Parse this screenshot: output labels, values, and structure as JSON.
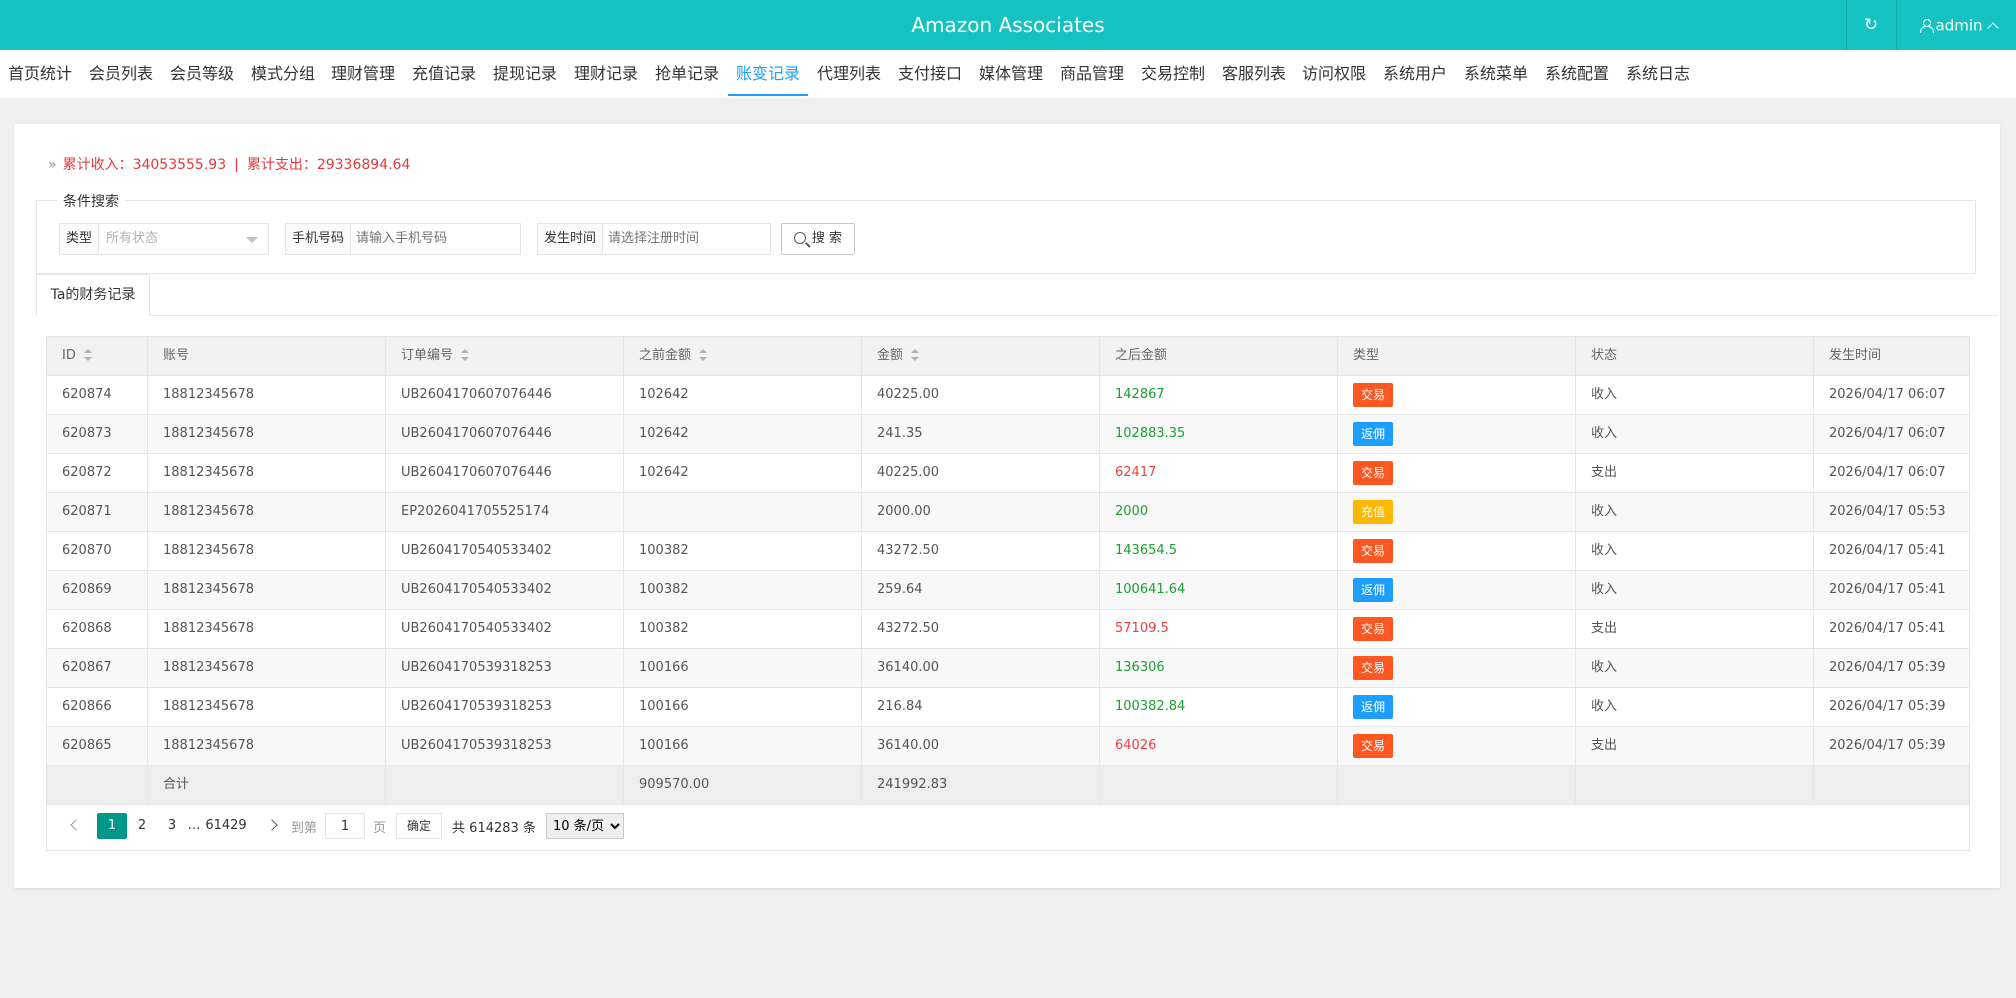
{
  "app": {
    "title": "Amazon Associates",
    "user": "admin",
    "refresh_icon": "refresh-icon",
    "brand_color": "#14c2c2"
  },
  "nav": {
    "active": 9,
    "items": [
      "首页统计",
      "会员列表",
      "会员等级",
      "模式分组",
      "理财管理",
      "充值记录",
      "提现记录",
      "理财记录",
      "抢单记录",
      "账变记录",
      "代理列表",
      "支付接口",
      "媒体管理",
      "商品管理",
      "交易控制",
      "客服列表",
      "访问权限",
      "系统用户",
      "系统菜单",
      "系统配置",
      "系统日志"
    ]
  },
  "summary": {
    "income_label": "累计收入：",
    "income_value": "34053555.93",
    "separator": "|",
    "expense_label": "累计支出：",
    "expense_value": "29336894.64"
  },
  "search": {
    "legend": "条件搜索",
    "type_label": "类型",
    "type_value": "所有状态",
    "phone_label": "手机号码",
    "phone_placeholder": "请输入手机号码",
    "time_label": "发生时间",
    "time_placeholder": "请选择注册时间",
    "button": "搜 索"
  },
  "tab": {
    "label": "Ta的财务记录"
  },
  "table": {
    "columns": [
      "ID",
      "账号",
      "订单编号",
      "之前金额",
      "金额",
      "之后金额",
      "类型",
      "状态",
      "发生时间"
    ],
    "rows": [
      {
        "id": "620874",
        "account": "18812345678",
        "order": "UB2604170607076446",
        "before": "102642",
        "amount": "40225.00",
        "after": "142867",
        "after_color": "green",
        "type": "交易",
        "type_color": "#ff5722",
        "status": "收入",
        "time": "2026/04/17 06:07"
      },
      {
        "id": "620873",
        "account": "18812345678",
        "order": "UB2604170607076446",
        "before": "102642",
        "amount": "241.35",
        "after": "102883.35",
        "after_color": "green",
        "type": "返佣",
        "type_color": "#1e9fff",
        "status": "收入",
        "time": "2026/04/17 06:07"
      },
      {
        "id": "620872",
        "account": "18812345678",
        "order": "UB2604170607076446",
        "before": "102642",
        "amount": "40225.00",
        "after": "62417",
        "after_color": "red",
        "type": "交易",
        "type_color": "#ff5722",
        "status": "支出",
        "time": "2026/04/17 06:07"
      },
      {
        "id": "620871",
        "account": "18812345678",
        "order": "EP2026041705525174",
        "before": "",
        "amount": "2000.00",
        "after": "2000",
        "after_color": "green",
        "type": "充值",
        "type_color": "#ffb800",
        "status": "收入",
        "time": "2026/04/17 05:53"
      },
      {
        "id": "620870",
        "account": "18812345678",
        "order": "UB2604170540533402",
        "before": "100382",
        "amount": "43272.50",
        "after": "143654.5",
        "after_color": "green",
        "type": "交易",
        "type_color": "#ff5722",
        "status": "收入",
        "time": "2026/04/17 05:41"
      },
      {
        "id": "620869",
        "account": "18812345678",
        "order": "UB2604170540533402",
        "before": "100382",
        "amount": "259.64",
        "after": "100641.64",
        "after_color": "green",
        "type": "返佣",
        "type_color": "#1e9fff",
        "status": "收入",
        "time": "2026/04/17 05:41"
      },
      {
        "id": "620868",
        "account": "18812345678",
        "order": "UB2604170540533402",
        "before": "100382",
        "amount": "43272.50",
        "after": "57109.5",
        "after_color": "red",
        "type": "交易",
        "type_color": "#ff5722",
        "status": "支出",
        "time": "2026/04/17 05:41"
      },
      {
        "id": "620867",
        "account": "18812345678",
        "order": "UB2604170539318253",
        "before": "100166",
        "amount": "36140.00",
        "after": "136306",
        "after_color": "green",
        "type": "交易",
        "type_color": "#ff5722",
        "status": "收入",
        "time": "2026/04/17 05:39"
      },
      {
        "id": "620866",
        "account": "18812345678",
        "order": "UB2604170539318253",
        "before": "100166",
        "amount": "216.84",
        "after": "100382.84",
        "after_color": "green",
        "type": "返佣",
        "type_color": "#1e9fff",
        "status": "收入",
        "time": "2026/04/17 05:39"
      },
      {
        "id": "620865",
        "account": "18812345678",
        "order": "UB2604170539318253",
        "before": "100166",
        "amount": "36140.00",
        "after": "64026",
        "after_color": "red",
        "type": "交易",
        "type_color": "#ff5722",
        "status": "支出",
        "time": "2026/04/17 05:39"
      }
    ],
    "footer": {
      "label": "合计",
      "before_total": "909570.00",
      "amount_total": "241992.83"
    }
  },
  "pagination": {
    "pages": [
      "1",
      "2",
      "3"
    ],
    "ellipsis": "…",
    "last": "61429",
    "goto_label": "到第",
    "goto_value": "1",
    "page_suffix": "页",
    "confirm": "确定",
    "total": "共 614283 条",
    "limit": "10 条/页"
  }
}
